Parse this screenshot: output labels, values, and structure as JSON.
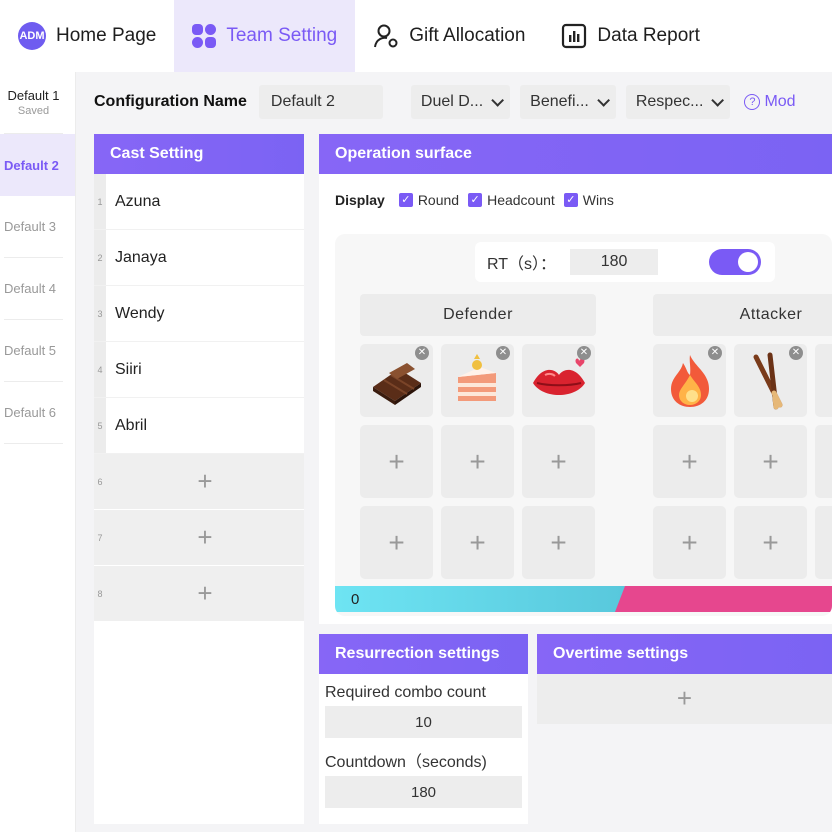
{
  "nav": {
    "items": [
      {
        "label": "Home Page",
        "icon": "logo-icon"
      },
      {
        "label": "Team Setting",
        "icon": "grid-icon",
        "active": true
      },
      {
        "label": "Gift Allocation",
        "icon": "user-gift-icon"
      },
      {
        "label": "Data Report",
        "icon": "bar-chart-icon"
      }
    ],
    "logo_text": "ADM",
    "accent": "#7a5af5"
  },
  "configs": {
    "items": [
      {
        "label": "Default 1",
        "sub": "Saved"
      },
      {
        "label": "Default 2",
        "active": true
      },
      {
        "label": "Default 3"
      },
      {
        "label": "Default 4"
      },
      {
        "label": "Default 5"
      },
      {
        "label": "Default 6"
      }
    ]
  },
  "config_row": {
    "label": "Configuration Name",
    "name_value": "Default 2",
    "dropdowns": [
      "Duel D...",
      "Benefi...",
      "Respec..."
    ],
    "mode_link": "Mod"
  },
  "cast": {
    "title": "Cast Setting",
    "members": [
      {
        "num": "1",
        "name": "Azuna"
      },
      {
        "num": "2",
        "name": "Janaya"
      },
      {
        "num": "3",
        "name": "Wendy"
      },
      {
        "num": "4",
        "name": "Siiri"
      },
      {
        "num": "5",
        "name": "Abril"
      }
    ],
    "empty_slots": [
      "6",
      "7",
      "8"
    ]
  },
  "operation": {
    "title": "Operation surface",
    "display_label": "Display",
    "checkboxes": [
      "Round",
      "Headcount",
      "Wins"
    ],
    "rt_label": "RT（s）：",
    "rt_value": "180",
    "toggle_on": true,
    "defender_label": "Defender",
    "attacker_label": "Attacker",
    "defender_gifts": [
      "chocolate-gift-icon",
      "cake-gift-icon",
      "lips-gift-icon"
    ],
    "attacker_gifts": [
      "fire-gift-icon",
      "pocky-gift-icon"
    ],
    "progress_value": "0"
  },
  "resurrection": {
    "title": "Resurrection settings",
    "combo_label": "Required combo count",
    "combo_value": "10",
    "countdown_label": "Countdown（seconds)",
    "countdown_value": "180"
  },
  "overtime": {
    "title": "Overtime settings"
  }
}
